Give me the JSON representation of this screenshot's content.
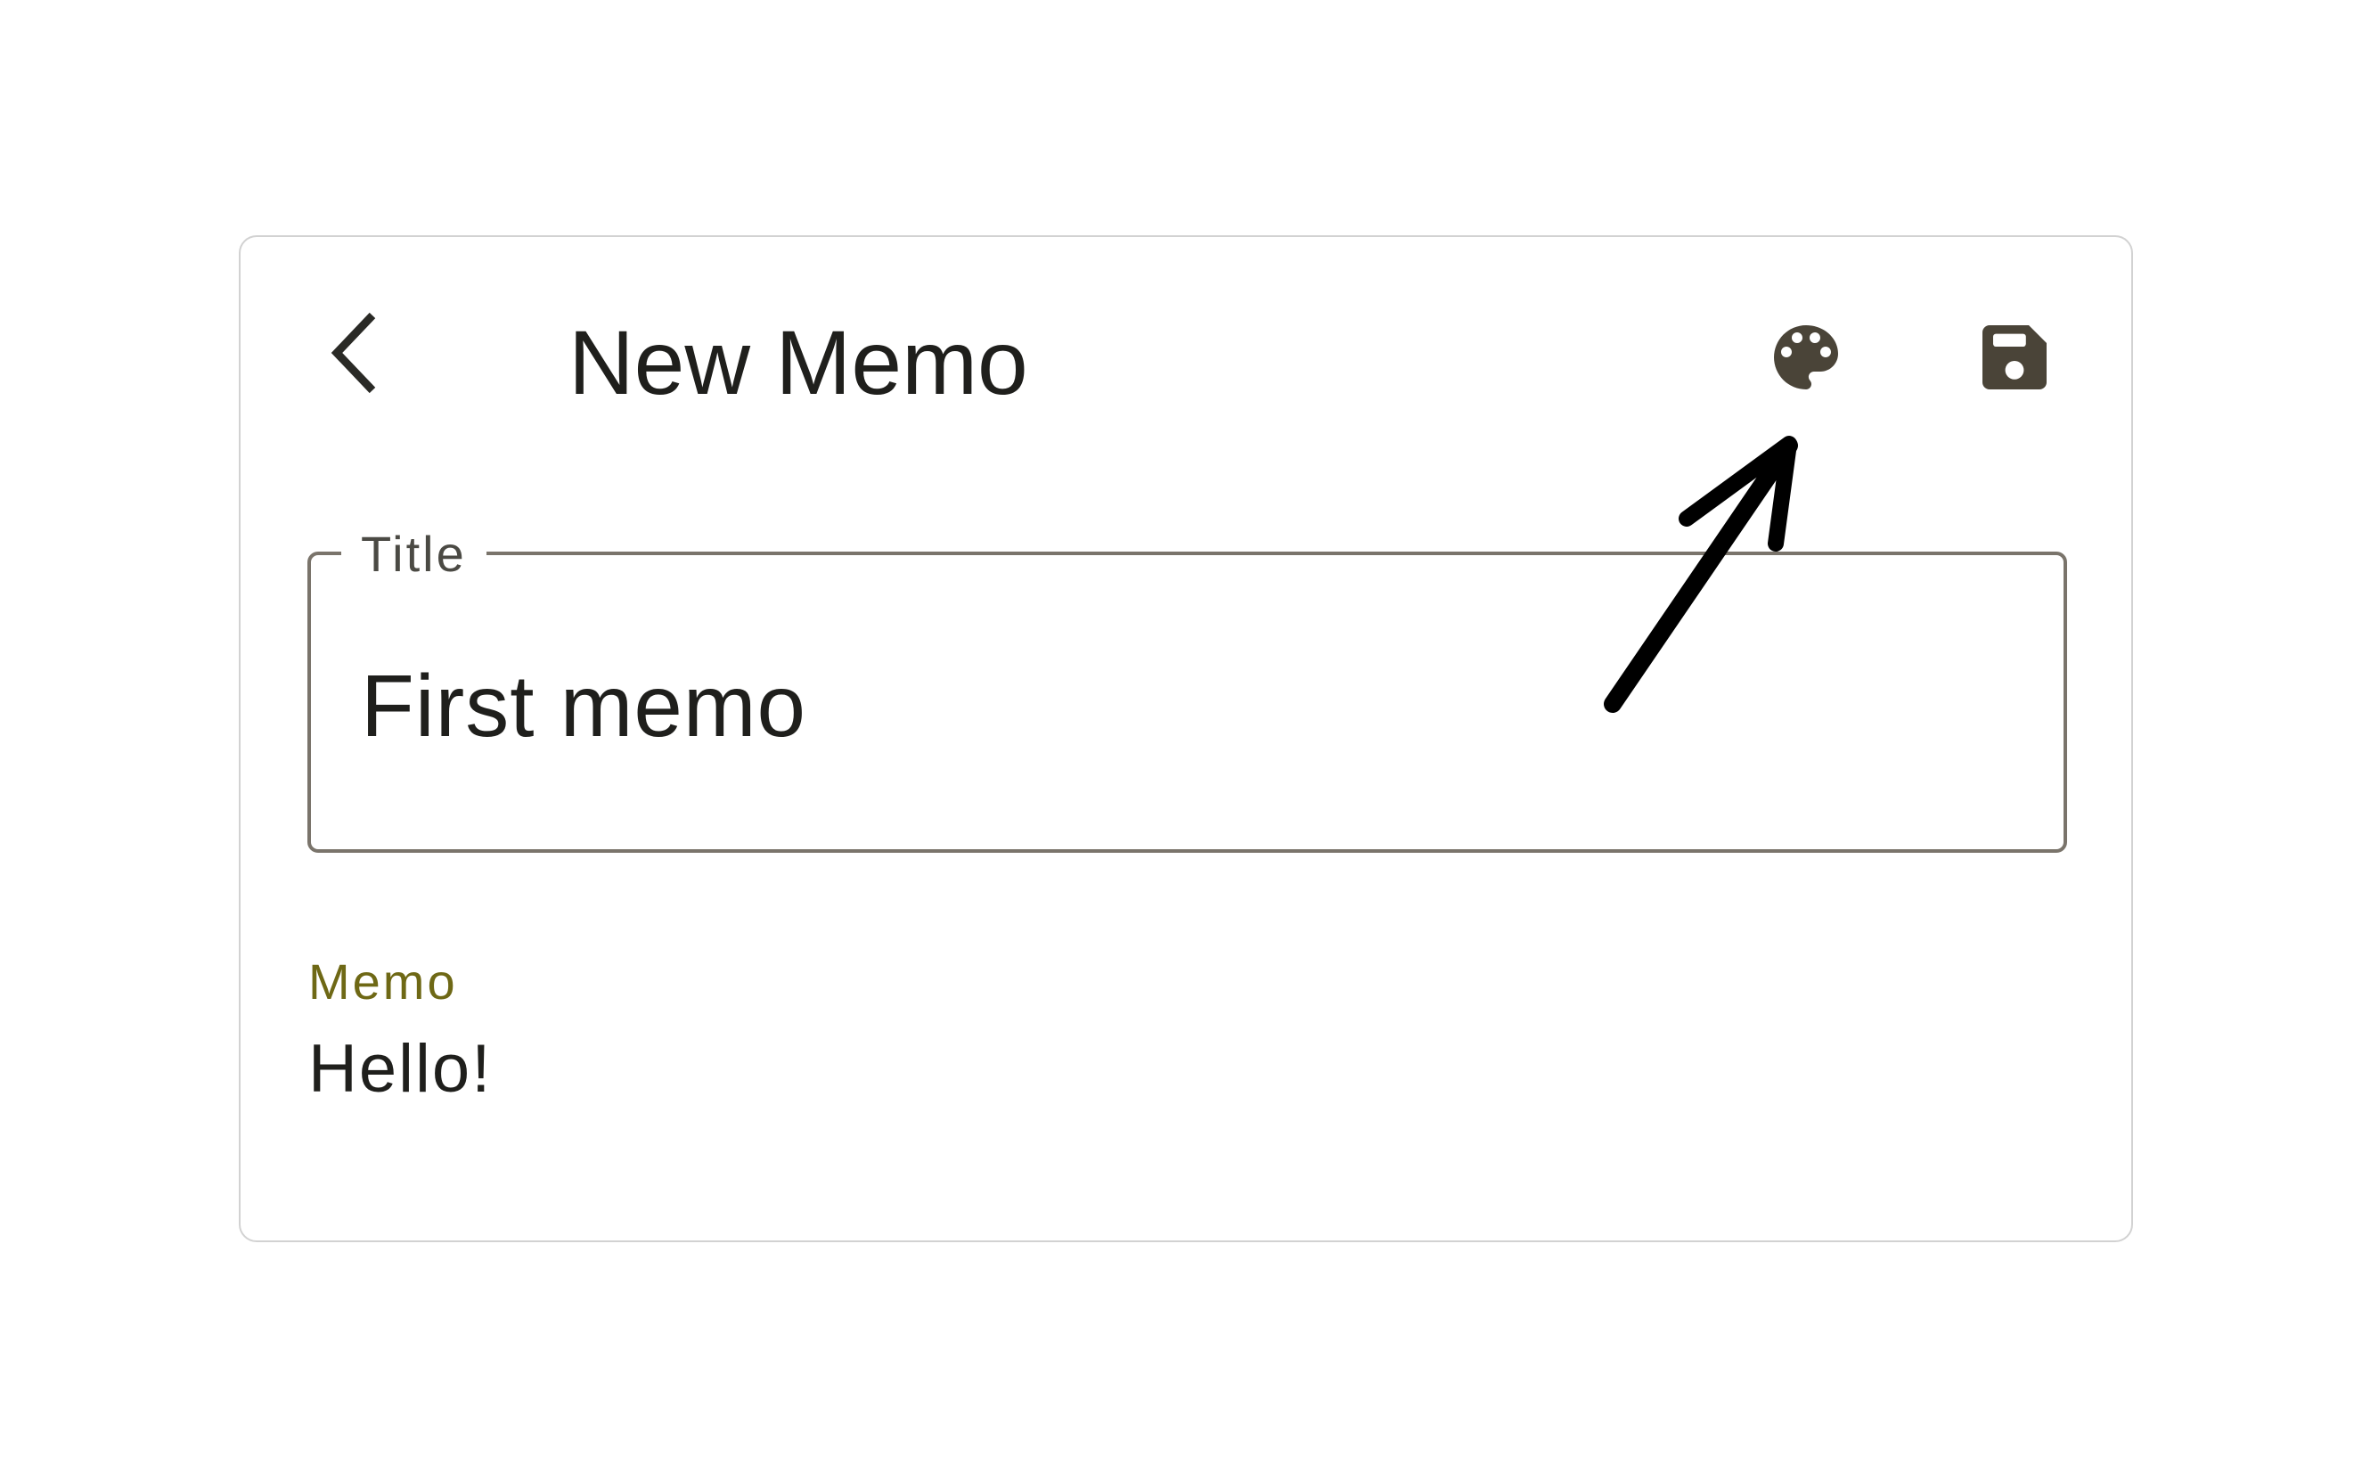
{
  "app": {
    "page_title": "New Memo"
  },
  "toolbar": {
    "back_icon": "chevron-left-icon",
    "palette_icon": "palette-icon",
    "save_icon": "floppy-disk-icon"
  },
  "form": {
    "title_label": "Title",
    "title_value": "First memo",
    "memo_label": "Memo",
    "memo_value": "Hello!"
  },
  "colors": {
    "icon": "#4a4438",
    "border": "#7a746b",
    "memo_label": "#6e6815",
    "text": "#1f1f1c",
    "annotation_arrow": "#000000"
  }
}
